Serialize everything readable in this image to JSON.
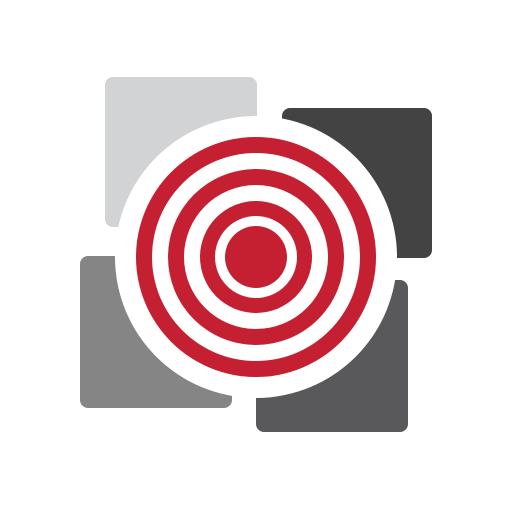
{
  "app": {
    "icon_name": "target-logo-icon"
  },
  "colors": {
    "background": "#ffffff",
    "tile_light": "#d2d3d5",
    "tile_dark": "#434343",
    "tile_mid_left": "#858586",
    "tile_mid_right": "#59595b",
    "target_red": "#c51f32",
    "target_white": "#ffffff"
  }
}
